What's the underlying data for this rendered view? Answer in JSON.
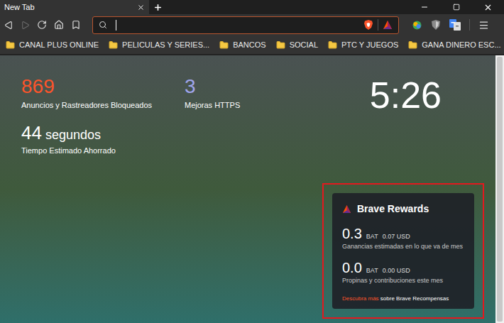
{
  "window": {
    "title": "New Tab"
  },
  "tabs": [
    {
      "label": "New Tab",
      "selected": true
    }
  ],
  "toolbar": {
    "back": {
      "disabled": false
    },
    "forward": {
      "disabled": true
    }
  },
  "address_bar": {
    "value": "",
    "focused": true
  },
  "bookmarks": [
    {
      "label": "CANAL PLUS ONLINE"
    },
    {
      "label": "PELICULAS Y SERIES..."
    },
    {
      "label": "BANCOS"
    },
    {
      "label": "SOCIAL"
    },
    {
      "label": "PTC Y JUEGOS"
    },
    {
      "label": "GANA DINERO ESC..."
    }
  ],
  "bookmarks_overflow": "»",
  "stats": [
    {
      "value": "869",
      "label": "Anuncios y Rastreadores Bloqueados",
      "color": "#fb542b"
    },
    {
      "value": "3",
      "label": "Mejoras HTTPS",
      "color": "#a0a5eb"
    }
  ],
  "time_saved": {
    "value": "44",
    "unit": "segundos",
    "label": "Tiempo Estimado Ahorrado"
  },
  "clock": "5:26",
  "rewards": {
    "title": "Brave Rewards",
    "highlighted": true,
    "rows": [
      {
        "amount": "0.3",
        "currency": "BAT",
        "usd": "0.07 USD",
        "label": "Ganancias estimadas en lo que va de mes"
      },
      {
        "amount": "0.0",
        "currency": "BAT",
        "usd": "0.00 USD",
        "label": "Propinas y contribuciones este mes"
      }
    ],
    "link": "Descubra más",
    "link_suffix": "sobre Brave Recompensas"
  }
}
